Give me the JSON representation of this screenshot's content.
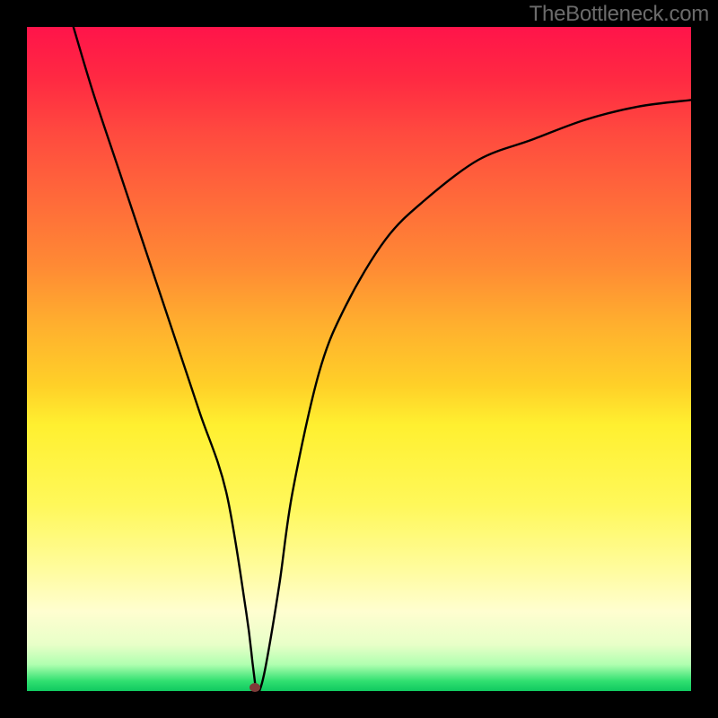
{
  "watermark": "TheBottleneck.com",
  "chart_data": {
    "type": "line",
    "title": "",
    "xlabel": "",
    "ylabel": "",
    "xlim": [
      0,
      100
    ],
    "ylim": [
      0,
      100
    ],
    "series": [
      {
        "name": "bottleneck-curve",
        "x": [
          7,
          10,
          14,
          18,
          22,
          26,
          30,
          33,
          34,
          34.5,
          35,
          36,
          38,
          40,
          44,
          48,
          54,
          60,
          68,
          76,
          84,
          92,
          100
        ],
        "values": [
          100,
          90,
          78,
          66,
          54,
          42,
          30,
          12,
          4,
          0,
          0,
          4,
          16,
          30,
          48,
          58,
          68,
          74,
          80,
          83,
          86,
          88,
          89
        ]
      }
    ],
    "marker": {
      "x": 34.3,
      "y": 0.5,
      "name": "optimal-point"
    },
    "background_gradient": {
      "top": "#ff144a",
      "mid_upper": "#ff8a34",
      "mid": "#fff030",
      "mid_lower": "#fffed0",
      "bottom": "#10c860"
    }
  }
}
